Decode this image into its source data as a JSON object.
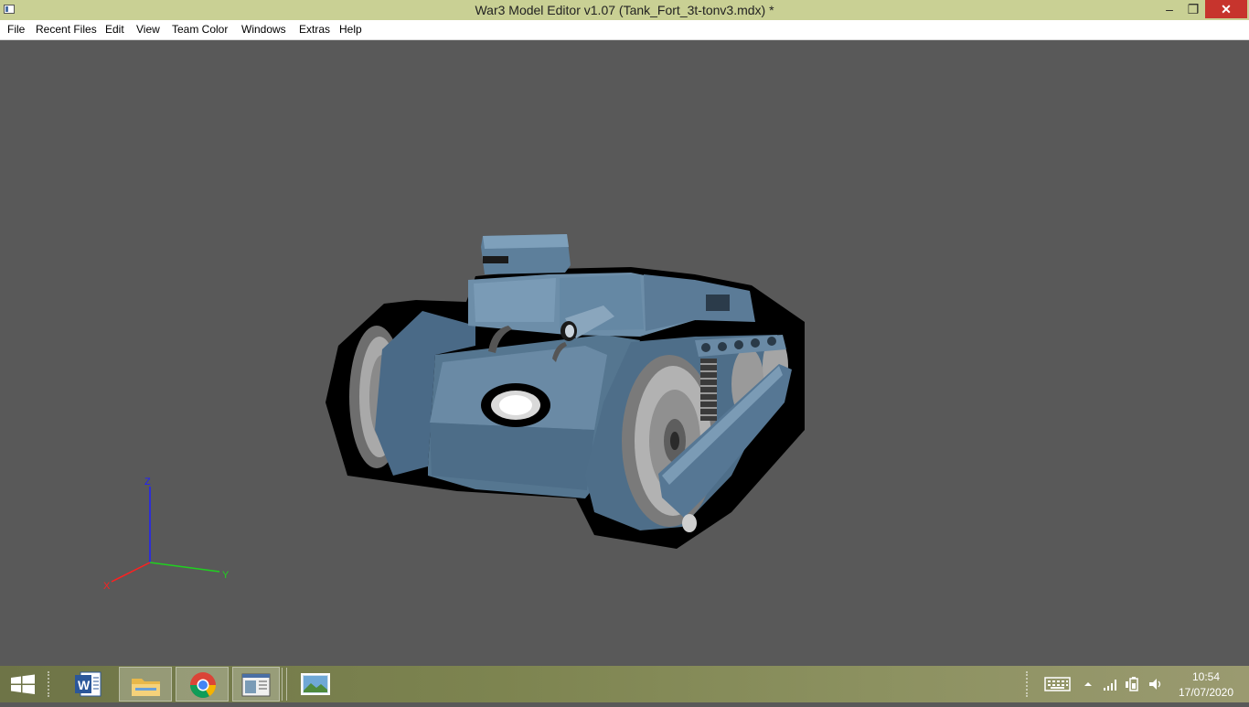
{
  "window": {
    "title": "War3 Model Editor v1.07 (Tank_Fort_3t-tonv3.mdx) *",
    "minimize_label": "–",
    "maximize_label": "❐",
    "close_label": "✕"
  },
  "menu": {
    "items": [
      {
        "label": "File"
      },
      {
        "label": "Recent Files"
      },
      {
        "label": "Edit"
      },
      {
        "label": "View"
      },
      {
        "label": "Team Color"
      },
      {
        "label": "Windows"
      },
      {
        "label": "Extras"
      },
      {
        "label": "Help"
      }
    ]
  },
  "viewport": {
    "background": "#595959",
    "axes": {
      "x_label": "X",
      "y_label": "Y",
      "z_label": "Z",
      "x_color": "#ff2020",
      "y_color": "#20d020",
      "z_color": "#2020ff"
    },
    "model_name": "Tank_Fort_3t-tonv3.mdx"
  },
  "taskbar": {
    "apps": [
      {
        "name": "start",
        "icon": "windows-logo-icon"
      },
      {
        "name": "word",
        "icon": "word-icon"
      },
      {
        "name": "file-explorer",
        "icon": "folder-icon"
      },
      {
        "name": "chrome",
        "icon": "chrome-icon"
      },
      {
        "name": "war3-model-editor",
        "icon": "model-editor-icon"
      },
      {
        "name": "photos",
        "icon": "photo-icon"
      }
    ],
    "tray": {
      "time": "10:54",
      "date": "17/07/2020",
      "icons": [
        "keyboard-icon",
        "show-hidden-icons-icon",
        "network-icon",
        "battery-icon",
        "volume-icon"
      ]
    }
  }
}
